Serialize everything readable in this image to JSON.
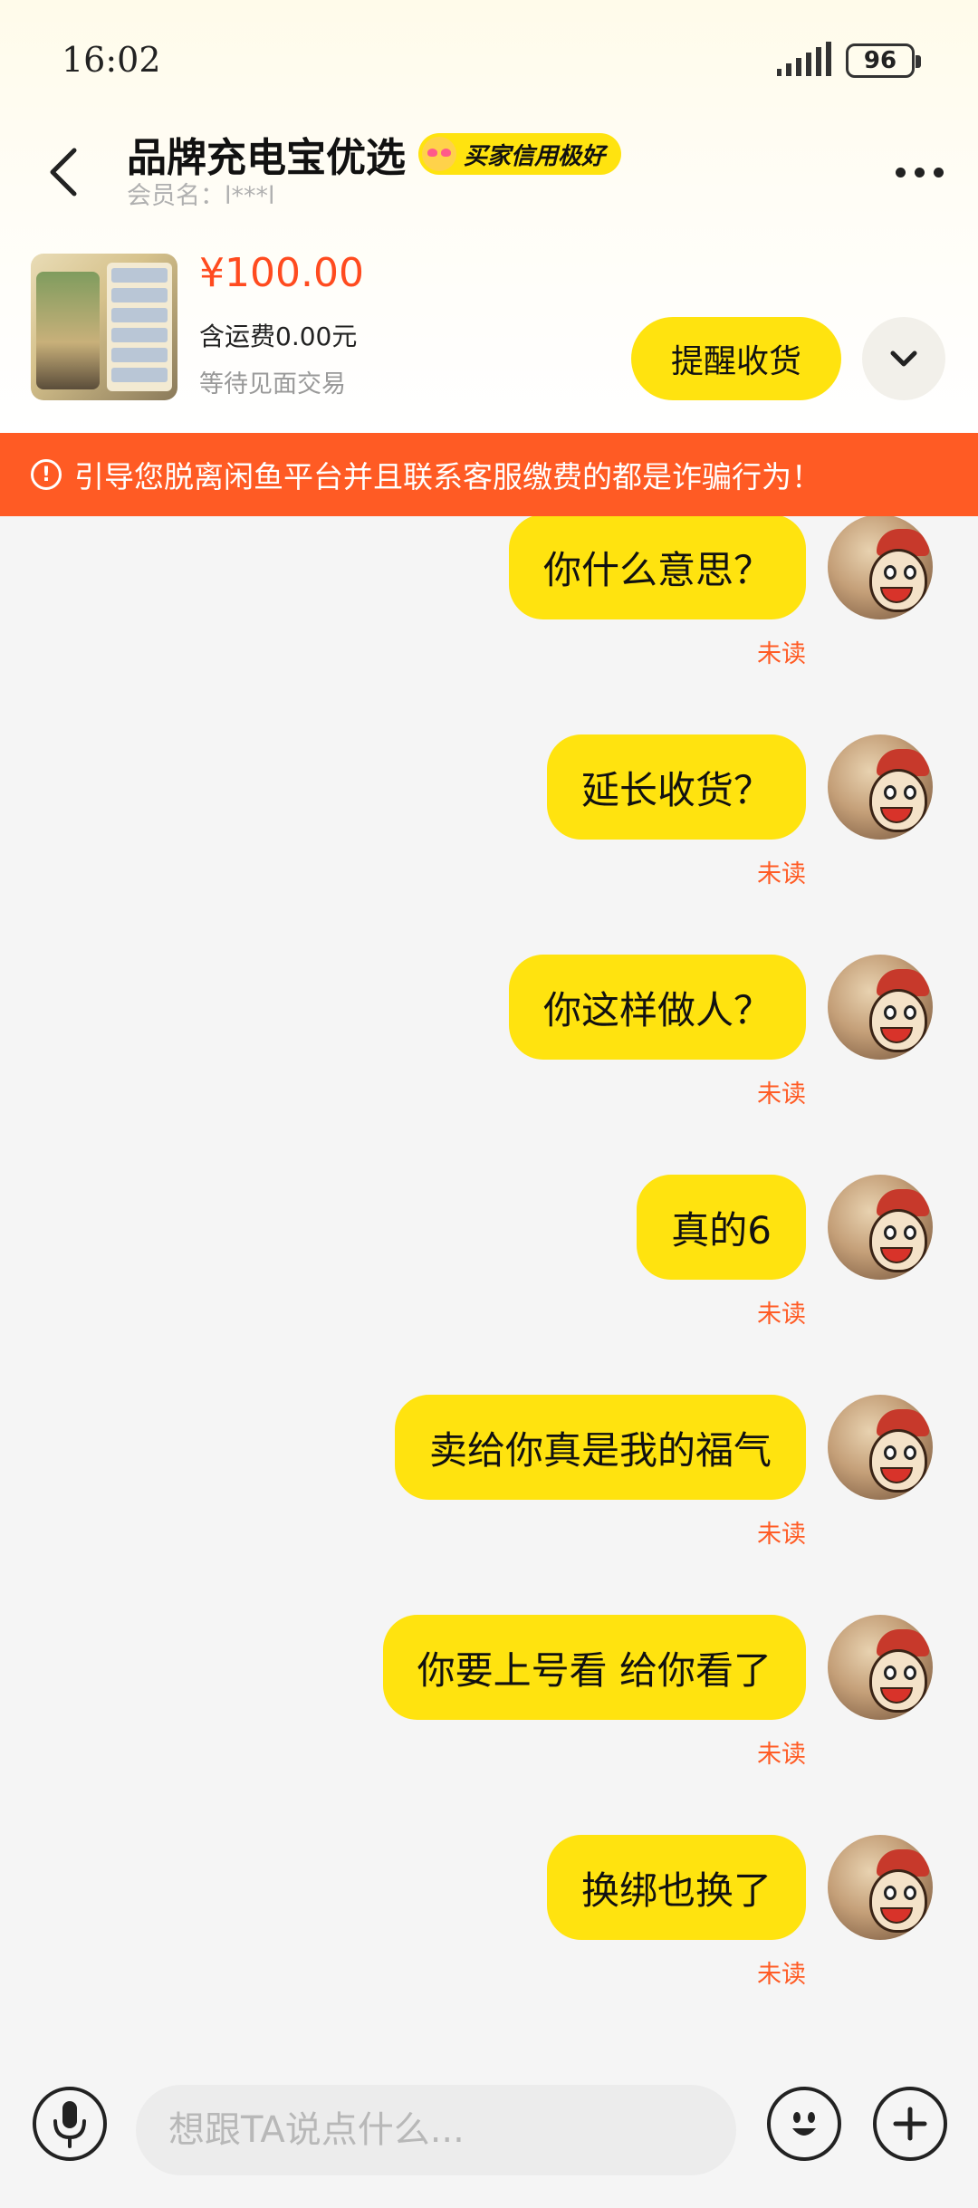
{
  "status_bar": {
    "time": "16:02",
    "battery": "96"
  },
  "header": {
    "shop_name": "品牌充电宝优选",
    "credit_badge": "买家信用极好",
    "member_label": "会员名：l***l"
  },
  "product": {
    "price": "¥100.00",
    "shipping": "含运费0.00元",
    "status": "等待见面交易",
    "remind_label": "提醒收货"
  },
  "warning": {
    "text": "引导您脱离闲鱼平台并且联系客服缴费的都是诈骗行为！"
  },
  "messages": [
    {
      "text": "你什么意思？",
      "status": "未读"
    },
    {
      "text": "延长收货？",
      "status": "未读"
    },
    {
      "text": "你这样做人？",
      "status": "未读"
    },
    {
      "text": "真的6",
      "status": "未读"
    },
    {
      "text": "卖给你真是我的福气",
      "status": "未读"
    },
    {
      "text": "你要上号看 给你看了",
      "status": "未读"
    },
    {
      "text": "换绑也换了",
      "status": "未读"
    }
  ],
  "input": {
    "placeholder": "想跟TA说点什么..."
  },
  "colors": {
    "accent": "#ffe30f",
    "warning": "#ff5b24",
    "price": "#ff4b1f"
  },
  "icons": [
    "back-arrow-icon",
    "more-dots-icon",
    "chevron-down-icon",
    "warning-icon",
    "microphone-icon",
    "smiley-icon",
    "plus-icon",
    "signal-icon",
    "battery-icon"
  ]
}
